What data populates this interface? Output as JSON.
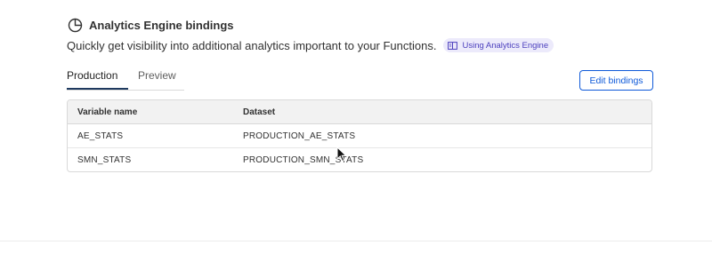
{
  "section": {
    "title": "Analytics Engine bindings",
    "icon": "pie-chart-icon",
    "description": "Quickly get visibility into additional analytics important to your Functions.",
    "doc_link": {
      "label": "Using Analytics Engine",
      "icon": "book-icon"
    }
  },
  "tabs": [
    {
      "label": "Production",
      "active": true
    },
    {
      "label": "Preview",
      "active": false
    }
  ],
  "actions": {
    "edit_bindings": "Edit bindings"
  },
  "table": {
    "columns": [
      "Variable name",
      "Dataset"
    ],
    "rows": [
      {
        "variable": "AE_STATS",
        "dataset": "PRODUCTION_AE_STATS"
      },
      {
        "variable": "SMN_STATS",
        "dataset": "PRODUCTION_SMN_STATS"
      }
    ]
  },
  "colors": {
    "accent": "#0f5ad9",
    "chip_bg": "#eceafb",
    "chip_text": "#4b3fbd",
    "tab_underline": "#1f3a5f"
  }
}
